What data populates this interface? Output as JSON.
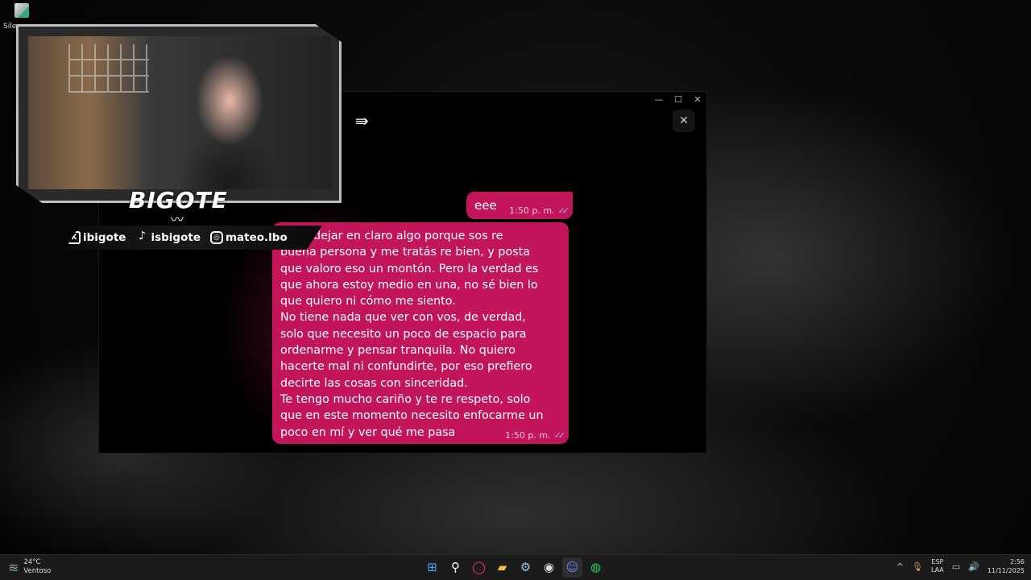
{
  "desktop": {
    "icon_label": "Sile"
  },
  "chat_window": {
    "controls": {
      "minimize": "—",
      "maximize": "☐",
      "close": "✕"
    },
    "forward_icon": "forward-arrows-icon",
    "close_panel_icon": "close-icon",
    "close_panel_glyph": "✕",
    "messages": [
      {
        "text": "eee",
        "time": "1:50 p. m.",
        "status": "read"
      },
      {
        "text": "uería dejar en claro algo porque sos re\nbuena persona y me tratás re bien, y posta\nque valoro eso un montón. Pero la verdad es\nque ahora estoy medio en una, no sé bien lo\nque quiero ni cómo me siento.\nNo tiene nada que ver con vos, de verdad,\nsolo que necesito un poco de espacio para\nordenarme y pensar tranquila. No quiero\nhacerte mal ni confundirte, por eso prefiero\ndecirte las cosas con sinceridad.\nTe tengo mucho cariño y te re respeto, solo\nque en este momento necesito enfocarme un\npoco en mí y ver qué me pasa",
        "time": "1:50 p. m.",
        "status": "read"
      }
    ],
    "ticks_glyph": "✓✓"
  },
  "overlay": {
    "brand": "BIGOTE",
    "mustache_glyph": "〰",
    "socials": [
      {
        "icon": "twitch-kick-icon",
        "glyph": "K",
        "handle": "ibigote"
      },
      {
        "icon": "tiktok-icon",
        "glyph": "♪",
        "handle": "isbigote"
      },
      {
        "icon": "instagram-icon",
        "glyph": "◎",
        "handle": "mateo.lbo"
      }
    ]
  },
  "taskbar": {
    "weather": {
      "temp": "24°C",
      "condition": "Ventoso"
    },
    "apps": [
      {
        "name": "start",
        "glyph": "⊞",
        "color": "#4fa3ff"
      },
      {
        "name": "search",
        "glyph": "⚲",
        "color": "#ffffff"
      },
      {
        "name": "opera",
        "glyph": "◯",
        "color": "#ff3355"
      },
      {
        "name": "file-explorer",
        "glyph": "▰",
        "color": "#f4c542"
      },
      {
        "name": "steam",
        "glyph": "⚙",
        "color": "#9fc6e8"
      },
      {
        "name": "obs",
        "glyph": "◉",
        "color": "#dddddd"
      },
      {
        "name": "discord",
        "glyph": "☺",
        "color": "#7a86ff"
      },
      {
        "name": "spotify",
        "glyph": "◍",
        "color": "#1ed760"
      }
    ],
    "tray": {
      "chevron": "^",
      "mic_glyph": "🎙",
      "lang_top": "ESP",
      "lang_bottom": "LAA",
      "network_glyph": "▭",
      "volume_glyph": "🔊",
      "time": "2:56",
      "date": "11/11/2025"
    }
  }
}
